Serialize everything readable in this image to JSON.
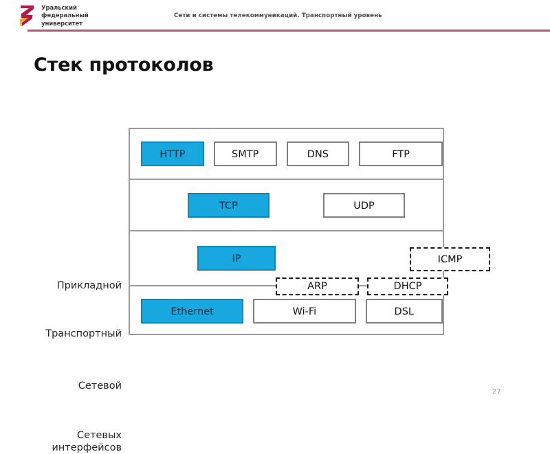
{
  "header": {
    "logo_text": "Уральский\nфедеральный\nуниверситет",
    "logo_icon": "ufu-swoosh-logo",
    "course_title": "Сети и системы телекоммуникаций. Транспортный уровень",
    "rule_color": "#b9526f"
  },
  "slide": {
    "title": "Стек протоколов",
    "page_number": "27"
  },
  "colors": {
    "highlight_fill": "#17a8e0",
    "highlight_border": "#1387b4",
    "box_border": "#808080",
    "stack_border": "#9a9a9a",
    "dashed_border": "#1a1a1a"
  },
  "diagram": {
    "type": "protocol-stack",
    "layers": [
      {
        "label": "Прикладной",
        "protocols": [
          {
            "name": "HTTP",
            "highlighted": true,
            "style": "solid"
          },
          {
            "name": "SMTP",
            "highlighted": false,
            "style": "solid"
          },
          {
            "name": "DNS",
            "highlighted": false,
            "style": "solid"
          },
          {
            "name": "FTP",
            "highlighted": false,
            "style": "solid"
          }
        ]
      },
      {
        "label": "Транспортный",
        "protocols": [
          {
            "name": "TCP",
            "highlighted": true,
            "style": "solid"
          },
          {
            "name": "UDP",
            "highlighted": false,
            "style": "solid"
          }
        ]
      },
      {
        "label": "Сетевой",
        "protocols": [
          {
            "name": "IP",
            "highlighted": true,
            "style": "solid"
          }
        ]
      },
      {
        "label": "Сетевых интерфейсов",
        "label_lines": [
          "Сетевых",
          "интерфейсов"
        ],
        "protocols": [
          {
            "name": "Ethernet",
            "highlighted": true,
            "style": "solid"
          },
          {
            "name": "Wi-Fi",
            "highlighted": false,
            "style": "solid"
          },
          {
            "name": "DSL",
            "highlighted": false,
            "style": "solid"
          }
        ]
      }
    ],
    "dashed_protocols": [
      {
        "name": "ICMP",
        "layer": "Сетевой",
        "style": "dashed"
      },
      {
        "name": "ARP",
        "layer": "boundary-network-link",
        "style": "dashed"
      },
      {
        "name": "DHCP",
        "layer": "boundary-network-link",
        "style": "dashed"
      }
    ]
  }
}
